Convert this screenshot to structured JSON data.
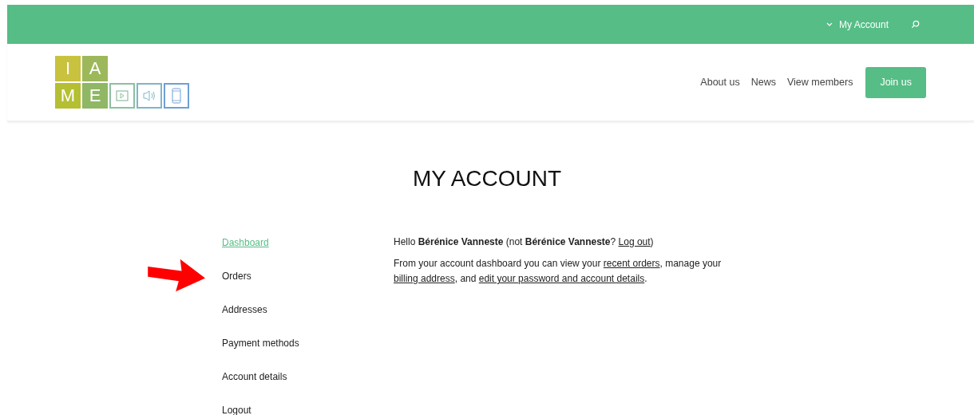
{
  "top_bar": {
    "account_menu": "My Account"
  },
  "logo": {
    "letters": [
      "I",
      "A",
      "M",
      "E"
    ]
  },
  "nav": {
    "links": [
      "About us",
      "News",
      "View members"
    ],
    "button": "Join us"
  },
  "page_title": "MY ACCOUNT",
  "sidebar": {
    "items": [
      {
        "label": "Dashboard",
        "selected": true
      },
      {
        "label": "Orders",
        "selected": false
      },
      {
        "label": "Addresses",
        "selected": false
      },
      {
        "label": "Payment methods",
        "selected": false
      },
      {
        "label": "Account details",
        "selected": false
      },
      {
        "label": "Logout",
        "selected": false
      }
    ]
  },
  "content": {
    "paragraphs": [
      [
        {
          "kind": "text",
          "text": "Hello **Bérénice Vanneste** (not **Bérénice Vanneste**? "
        },
        {
          "kind": "link",
          "text": "Log out"
        },
        {
          "kind": "text",
          "text": ")"
        }
      ],
      [
        {
          "kind": "text",
          "text": "From your account dashboard you can view your "
        },
        {
          "kind": "link",
          "text": "recent orders"
        },
        {
          "kind": "text",
          "text": ", manage your "
        },
        {
          "kind": "link",
          "text": "billing address"
        },
        {
          "kind": "text",
          "text": ", and "
        },
        {
          "kind": "link",
          "text": "edit your password and account details"
        },
        {
          "kind": "text",
          "text": "."
        }
      ]
    ]
  }
}
